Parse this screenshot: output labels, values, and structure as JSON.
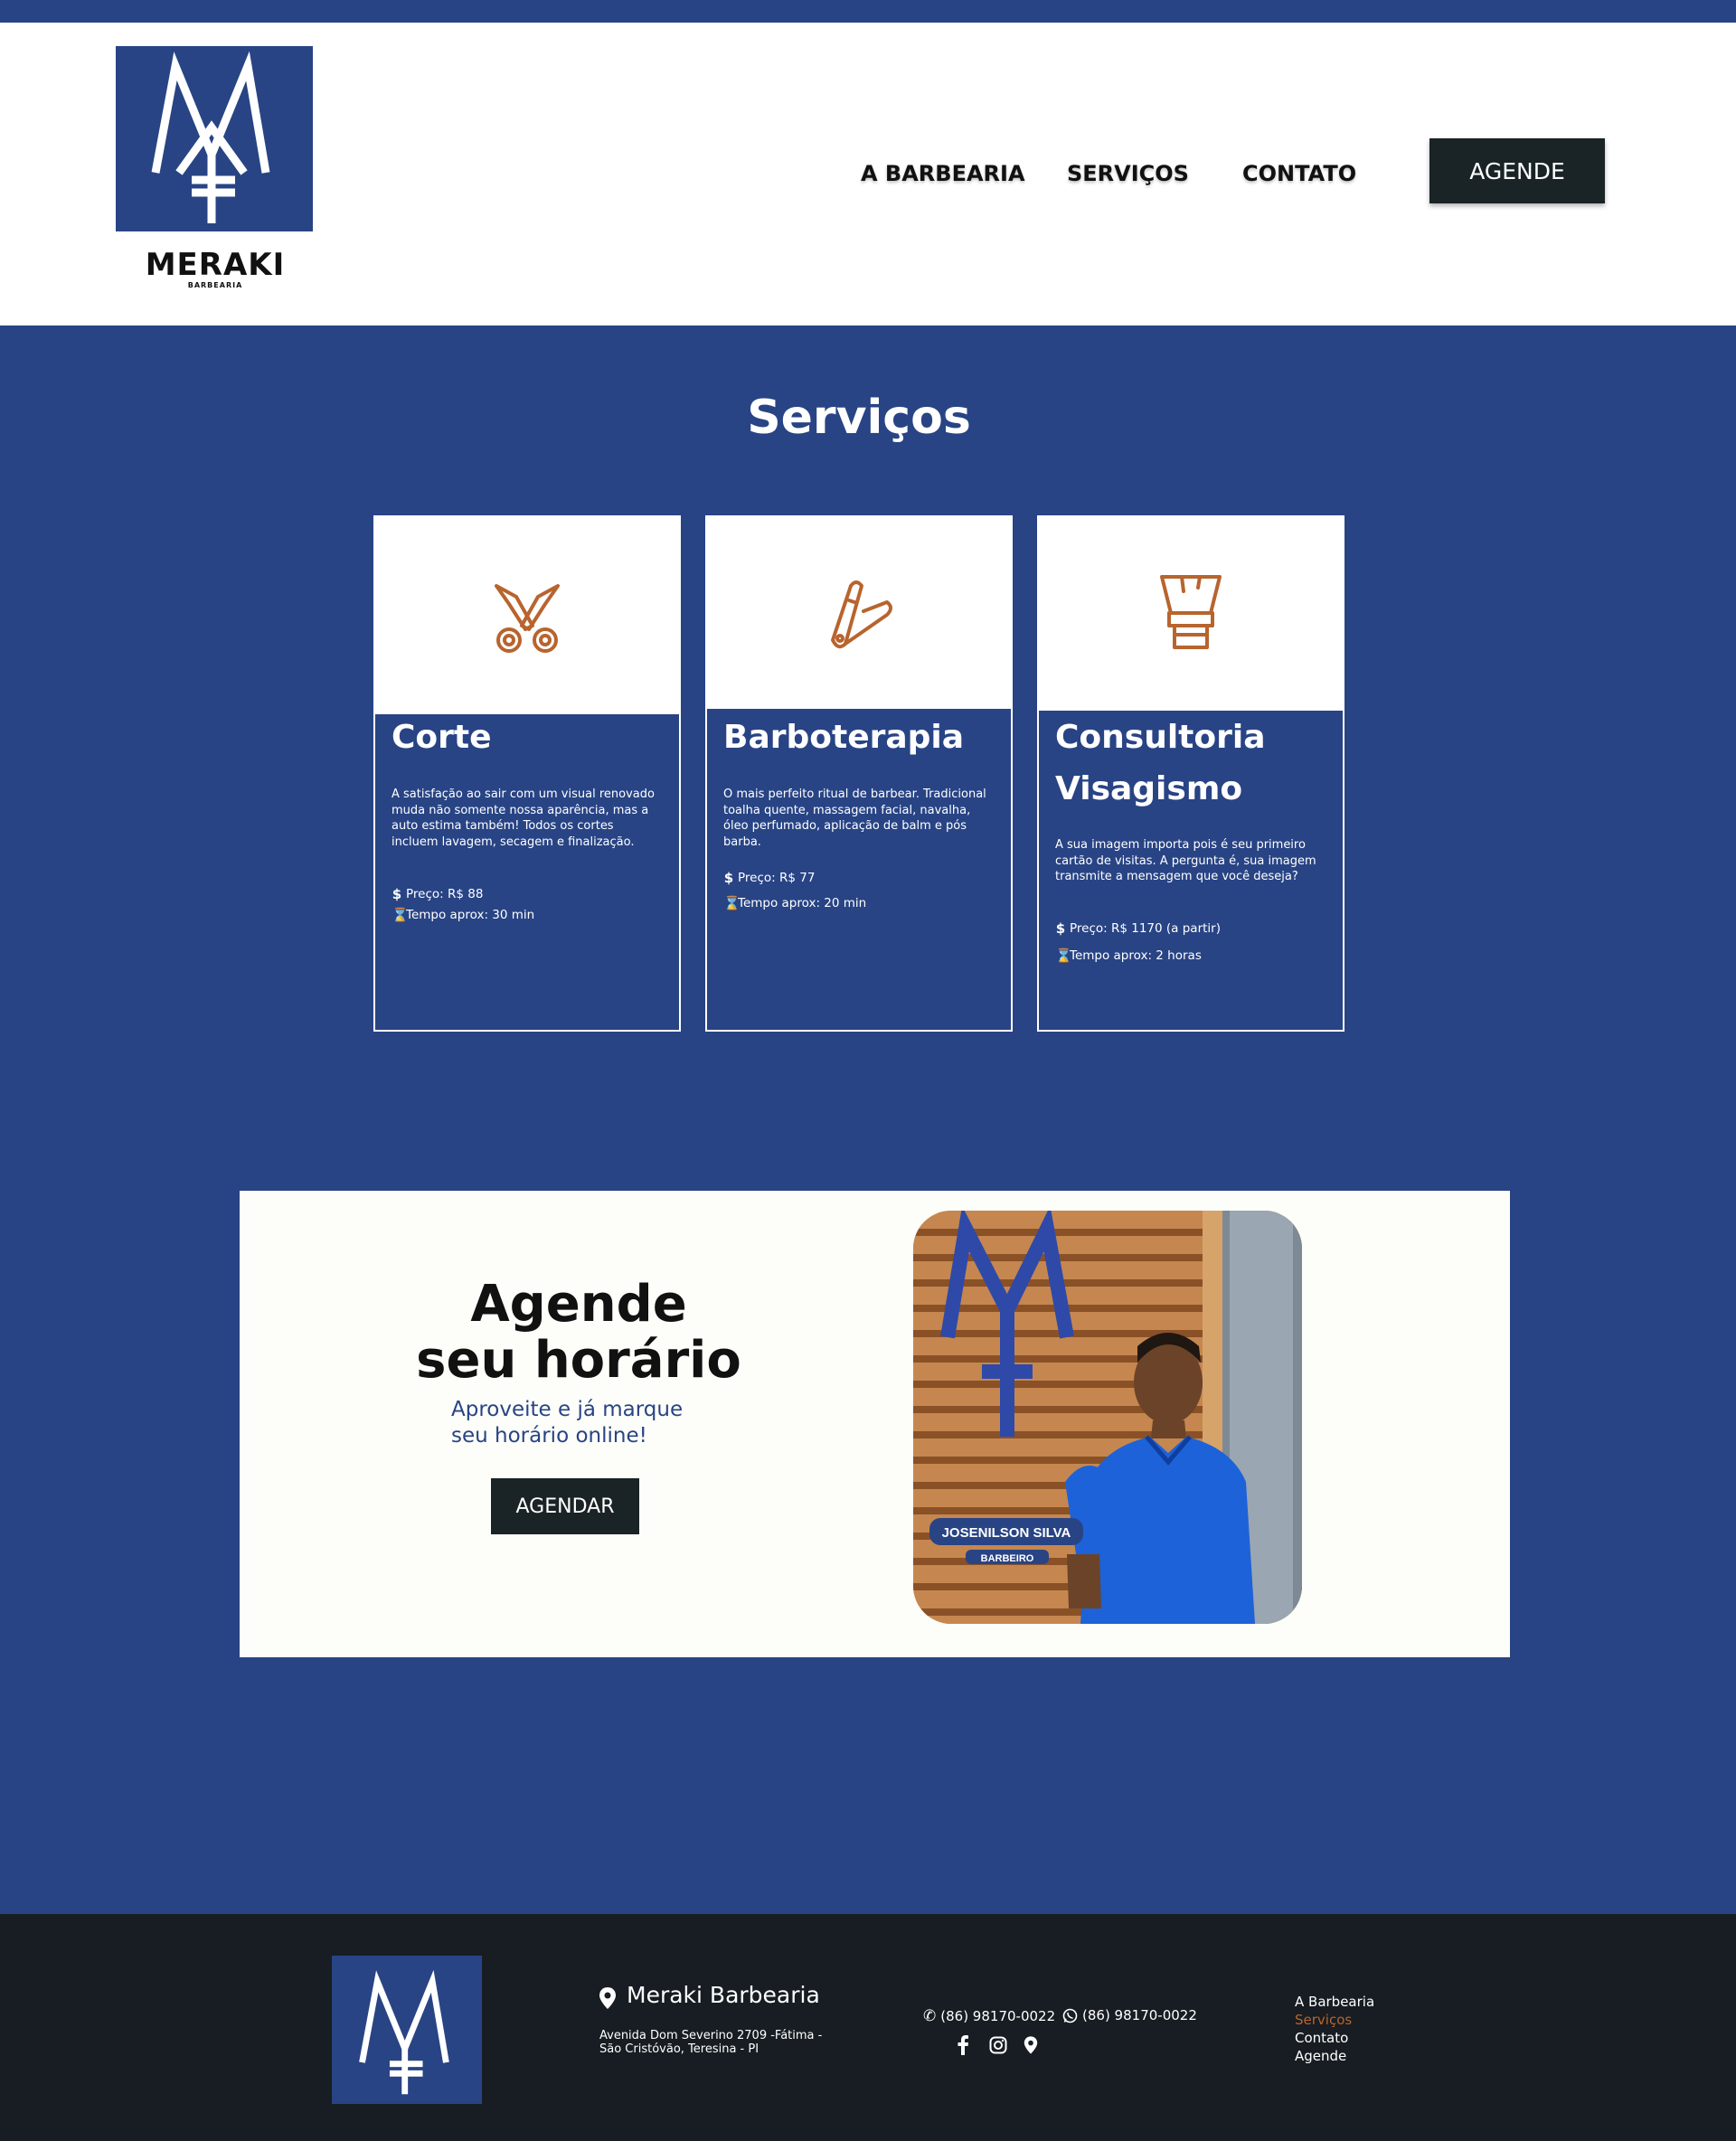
{
  "brand": {
    "name": "MERAKI",
    "sub": "BARBEARIA"
  },
  "nav": {
    "items": [
      "A BARBEARIA",
      "SERVIÇOS",
      "CONTATO"
    ],
    "cta": "AGENDE"
  },
  "services": {
    "title": "Serviços",
    "cards": [
      {
        "icon": "scissors-icon",
        "title": "Corte",
        "desc": "A satisfação ao sair com um visual renovado muda não somente nossa aparência, mas a auto estima também! Todos os cortes incluem lavagem, secagem e finalização.",
        "price": "Preço: R$ 88",
        "time": "Tempo aprox: 30 min"
      },
      {
        "icon": "razor-icon",
        "title": "Barboterapia",
        "desc": "O mais perfeito ritual de barbear. Tradicional toalha quente, massagem facial, navalha, óleo perfumado, aplicação de balm e pós barba.",
        "price": "Preço: R$ 77",
        "time": "Tempo aprox: 20 min"
      },
      {
        "icon": "brush-icon",
        "title_line1": "Consultoria",
        "title_line2": "Visagismo",
        "desc": "A sua imagem importa pois é seu primeiro cartão de visitas. A pergunta é, sua imagem transmite a mensagem que você deseja?",
        "price": "Preço: R$ 1170 (a partir)",
        "time": "Tempo aprox: 2 horas"
      }
    ]
  },
  "promo": {
    "title_line1": "Agende",
    "title_line2": "seu horário",
    "sub_line1": "Aproveite e já marque",
    "sub_line2": "seu horário online!",
    "button": "AGENDAR",
    "photo_name": "JOSENILSON SILVA",
    "photo_role": "BARBEIRO"
  },
  "footer": {
    "name": "Meraki Barbearia",
    "addr_line1": "Avenida Dom Severino 2709 -Fátima -",
    "addr_line2": "São Cristóvão, Teresina - PI",
    "phone": "(86) 98170-0022",
    "whatsapp": "(86) 98170-0022",
    "links": [
      "A Barbearia",
      "Serviços",
      "Contato",
      "Agende"
    ],
    "active_link": "Serviços"
  },
  "colors": {
    "brand_blue": "#284485",
    "dark": "#1a2326",
    "accent": "#b8642e"
  }
}
